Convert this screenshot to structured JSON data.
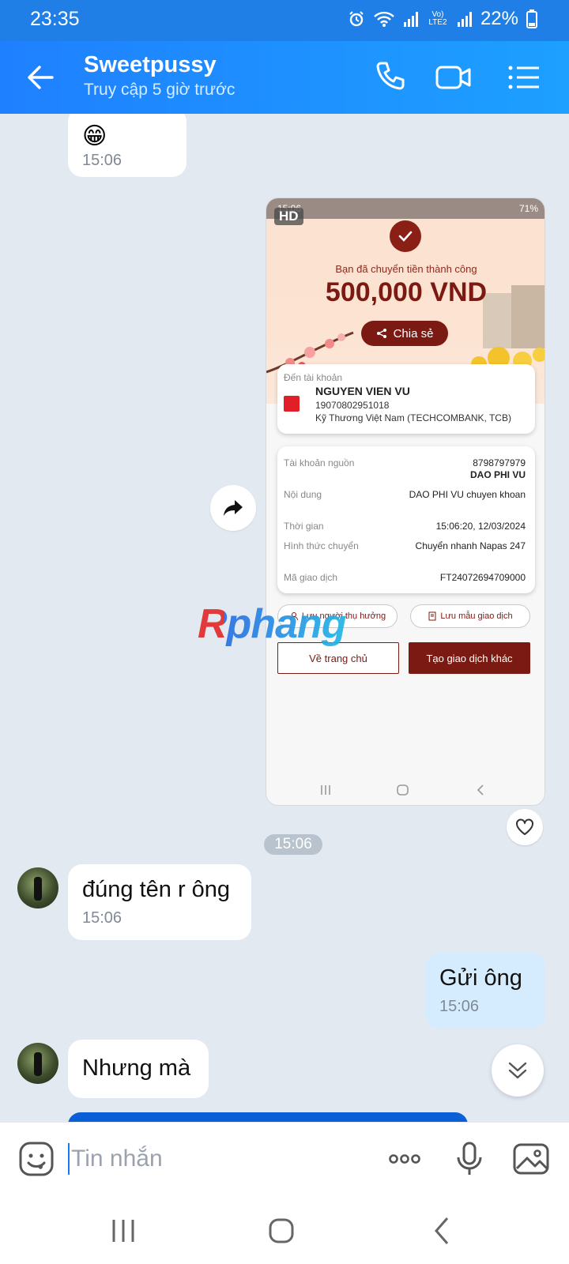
{
  "status_bar": {
    "time": "23:35",
    "network": "Vo) LTE2",
    "battery": "22%"
  },
  "header": {
    "contact_name": "Sweetpussy",
    "last_seen": "Truy cập 5 giờ trước"
  },
  "messages": {
    "emoji_msg": {
      "emoji": "😁",
      "time": "15:06"
    },
    "image_time": "15:06",
    "msg1": {
      "text": "đúng tên r ông",
      "time": "15:06"
    },
    "msg2": {
      "text": "Gửi ông",
      "time": "15:06"
    },
    "msg3": {
      "text": "Nhưng mà"
    }
  },
  "screenshot": {
    "hd": "HD",
    "status_time": "15:06",
    "status_battery": "71%",
    "success_msg": "Bạn đã chuyển tiền thành công",
    "amount": "500,000 VND",
    "share": "Chia sẻ",
    "to_label": "Đến tài khoản",
    "recipient_name": "NGUYEN VIEN VU",
    "recipient_account": "19070802951018",
    "recipient_bank": "Kỹ Thương Việt Nam (TECHCOMBANK, TCB)",
    "details": [
      {
        "label": "Tài khoản nguồn",
        "value": "8798797979",
        "value2": "DAO PHI VU"
      },
      {
        "label": "Nội dung",
        "value": "DAO PHI VU chuyen khoan"
      },
      {
        "label": "Thời gian",
        "value": "15:06:20, 12/03/2024"
      },
      {
        "label": "Hình thức chuyển",
        "value": "Chuyển nhanh Napas 247"
      },
      {
        "label": "Mã giao dịch",
        "value": "FT24072694709000"
      }
    ],
    "save_recipient": "Lưu người thụ hưởng",
    "save_template": "Lưu mẫu giao dịch",
    "home": "Về trang chủ",
    "new_txn": "Tạo giao dịch khác"
  },
  "watermark": "Rphang",
  "input": {
    "placeholder": "Tin nhắn"
  },
  "colors": {
    "header": "#1f80ff",
    "my_bubble": "#d4ecfe",
    "bank_brand": "#7b1a12"
  }
}
